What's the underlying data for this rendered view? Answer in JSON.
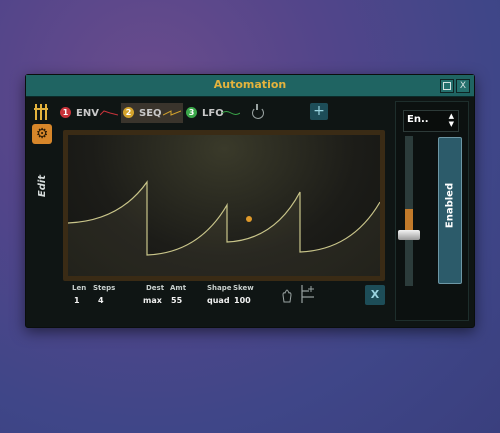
{
  "window": {
    "title": "Automation",
    "close_label": "X"
  },
  "sidebar": {
    "mode_label": "Edit"
  },
  "tabs": [
    {
      "number": "1",
      "label": "ENV",
      "color": "#c8333a"
    },
    {
      "number": "2",
      "label": "SEQ",
      "color": "#d4a32c",
      "active": true
    },
    {
      "number": "3",
      "label": "LFO",
      "color": "#3ba84a"
    }
  ],
  "toolbar": {
    "add_label": "+"
  },
  "params": {
    "len": {
      "label": "Len",
      "value": "1"
    },
    "steps": {
      "label": "Steps",
      "value": "4"
    },
    "dest": {
      "label": "Dest",
      "value": "max"
    },
    "amt": {
      "label": "Amt",
      "value": "55"
    },
    "shape": {
      "label": "Shape",
      "value": "quad"
    },
    "skew": {
      "label": "Skew",
      "value": "100"
    }
  },
  "clear_label": "X",
  "right_panel": {
    "select_value": "En..",
    "enabled_label": "Enabled",
    "slider_level": 0.35
  },
  "colors": {
    "accent": "#e4b33d",
    "titlebar": "#1f6462",
    "curve": "#c9c58a",
    "playhead": "#e09a2a"
  },
  "curve": {
    "steps": 4,
    "shape": "quad",
    "playhead_position": 0.58
  }
}
